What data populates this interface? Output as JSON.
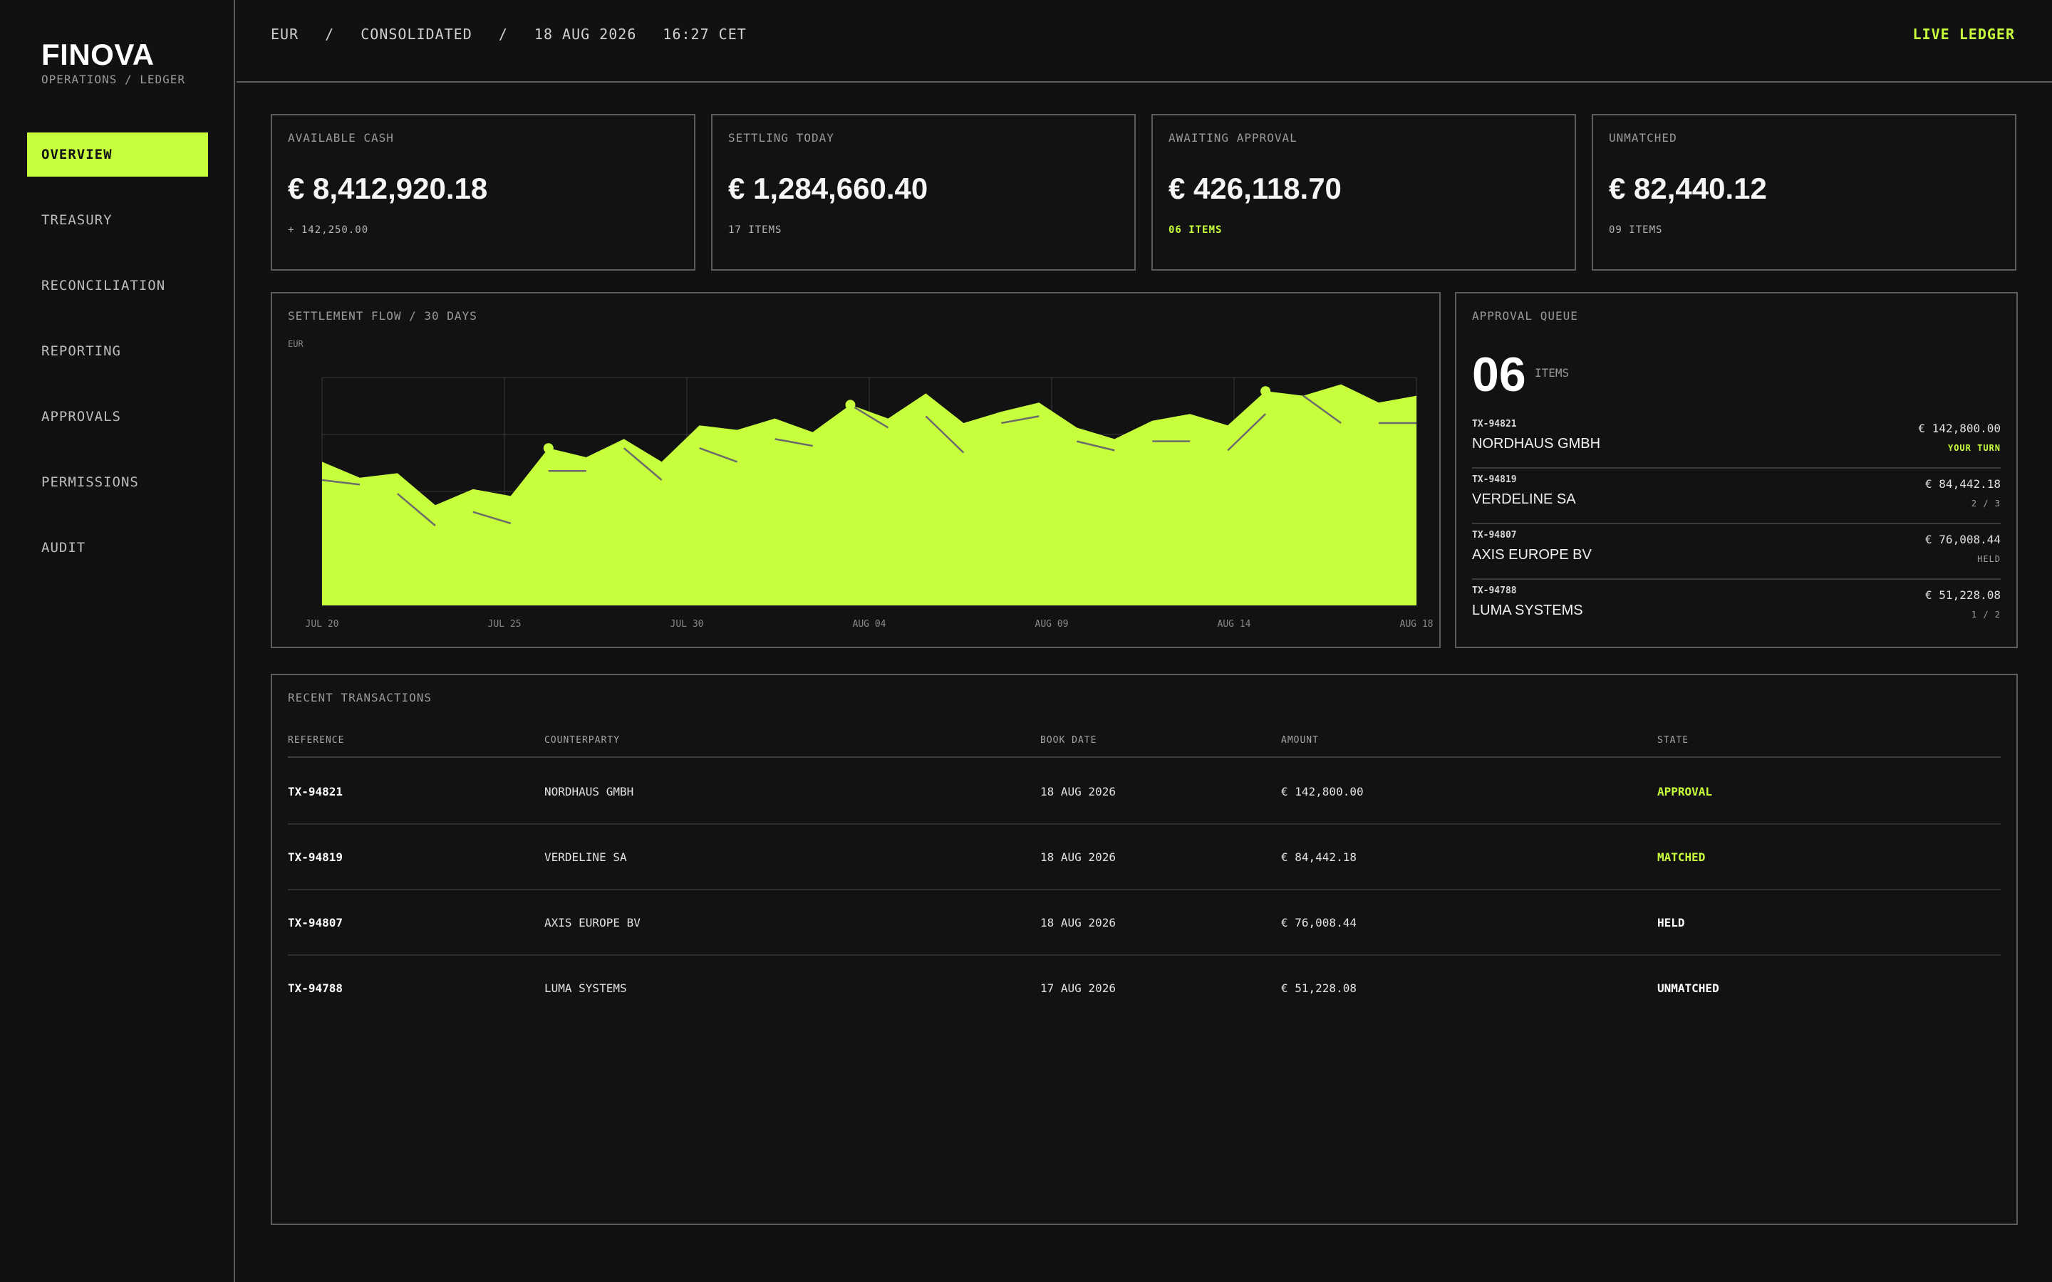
{
  "brand": {
    "name": "FINOVA",
    "subtitle": "OPERATIONS / LEDGER"
  },
  "sidebar": {
    "items": [
      {
        "label": "OVERVIEW",
        "active": true
      },
      {
        "label": "TREASURY"
      },
      {
        "label": "RECONCILIATION"
      },
      {
        "label": "REPORTING"
      },
      {
        "label": "APPROVALS"
      },
      {
        "label": "PERMISSIONS"
      },
      {
        "label": "AUDIT"
      }
    ]
  },
  "header": {
    "crumbs": [
      "EUR",
      "/",
      "CONSOLIDATED",
      "/",
      "18 AUG 2026",
      "16:27 CET"
    ],
    "live_label": "LIVE LEDGER"
  },
  "kpis": [
    {
      "label": "AVAILABLE CASH",
      "value": "€ 8,412,920.18",
      "sub": "+ 142,250.00"
    },
    {
      "label": "SETTLING TODAY",
      "value": "€ 1,284,660.40",
      "sub": "17 ITEMS"
    },
    {
      "label": "AWAITING APPROVAL",
      "value": "€ 426,118.70",
      "sub": "06 ITEMS"
    },
    {
      "label": "UNMATCHED",
      "value": "€ 82,440.12",
      "sub": "09 ITEMS"
    }
  ],
  "chart": {
    "title": "SETTLEMENT FLOW / 30 DAYS",
    "unit": "EUR"
  },
  "chart_data": {
    "type": "area",
    "title": "SETTLEMENT FLOW / 30 DAYS",
    "ylabel": "EUR",
    "x_ticks": [
      "JUL 20",
      "JUL 25",
      "JUL 30",
      "AUG 04",
      "AUG 09",
      "AUG 14",
      "AUG 18"
    ],
    "ylim": [
      0,
      100
    ],
    "series": [
      {
        "values": [
          63,
          56,
          58,
          44,
          51,
          48,
          69,
          65,
          73,
          63,
          79,
          77,
          82,
          76,
          88,
          82,
          93,
          80,
          85,
          89,
          78,
          73,
          81,
          84,
          79,
          94,
          92,
          97,
          89,
          92
        ]
      }
    ],
    "trend_segments": [
      [
        55,
        53
      ],
      [
        49,
        35
      ],
      [
        41,
        36
      ],
      [
        59,
        59
      ],
      [
        69,
        55
      ],
      [
        69,
        63
      ],
      [
        73,
        70
      ],
      [
        88,
        78
      ],
      [
        83,
        67
      ],
      [
        80,
        83
      ],
      [
        72,
        68
      ],
      [
        72,
        72
      ],
      [
        68,
        84
      ],
      [
        92,
        80
      ],
      [
        80,
        80
      ]
    ],
    "markers": [
      6,
      14,
      25
    ],
    "grid": true,
    "color": "#c7ff3d"
  },
  "queue": {
    "title": "APPROVAL QUEUE",
    "count": "06",
    "count_label": "ITEMS",
    "items": [
      {
        "ref": "TX-94821",
        "name": "NORDHAUS GMBH",
        "amount": "€ 142,800.00",
        "status": "YOUR TURN",
        "accent": true
      },
      {
        "ref": "TX-94819",
        "name": "VERDELINE SA",
        "amount": "€ 84,442.18",
        "status": "2 / 3"
      },
      {
        "ref": "TX-94807",
        "name": "AXIS EUROPE BV",
        "amount": "€ 76,008.44",
        "status": "HELD"
      },
      {
        "ref": "TX-94788",
        "name": "LUMA SYSTEMS",
        "amount": "€ 51,228.08",
        "status": "1 / 2"
      }
    ]
  },
  "transactions": {
    "title": "RECENT TRANSACTIONS",
    "columns": [
      "REFERENCE",
      "COUNTERPARTY",
      "BOOK DATE",
      "AMOUNT",
      "STATE"
    ],
    "rows": [
      {
        "ref": "TX-94821",
        "counterparty": "NORDHAUS GMBH",
        "date": "18 AUG 2026",
        "amount": "€ 142,800.00",
        "state": "APPROVAL",
        "state_style": "accent"
      },
      {
        "ref": "TX-94819",
        "counterparty": "VERDELINE SA",
        "date": "18 AUG 2026",
        "amount": "€ 84,442.18",
        "state": "MATCHED",
        "state_style": "accent"
      },
      {
        "ref": "TX-94807",
        "counterparty": "AXIS EUROPE BV",
        "date": "18 AUG 2026",
        "amount": "€ 76,008.44",
        "state": "HELD",
        "state_style": "white"
      },
      {
        "ref": "TX-94788",
        "counterparty": "LUMA SYSTEMS",
        "date": "17 AUG 2026",
        "amount": "€ 51,228.08",
        "state": "UNMATCHED",
        "state_style": "white"
      }
    ]
  },
  "colors": {
    "accent": "#c7ff3d",
    "background": "#111111",
    "border": "#5c5c5c"
  }
}
